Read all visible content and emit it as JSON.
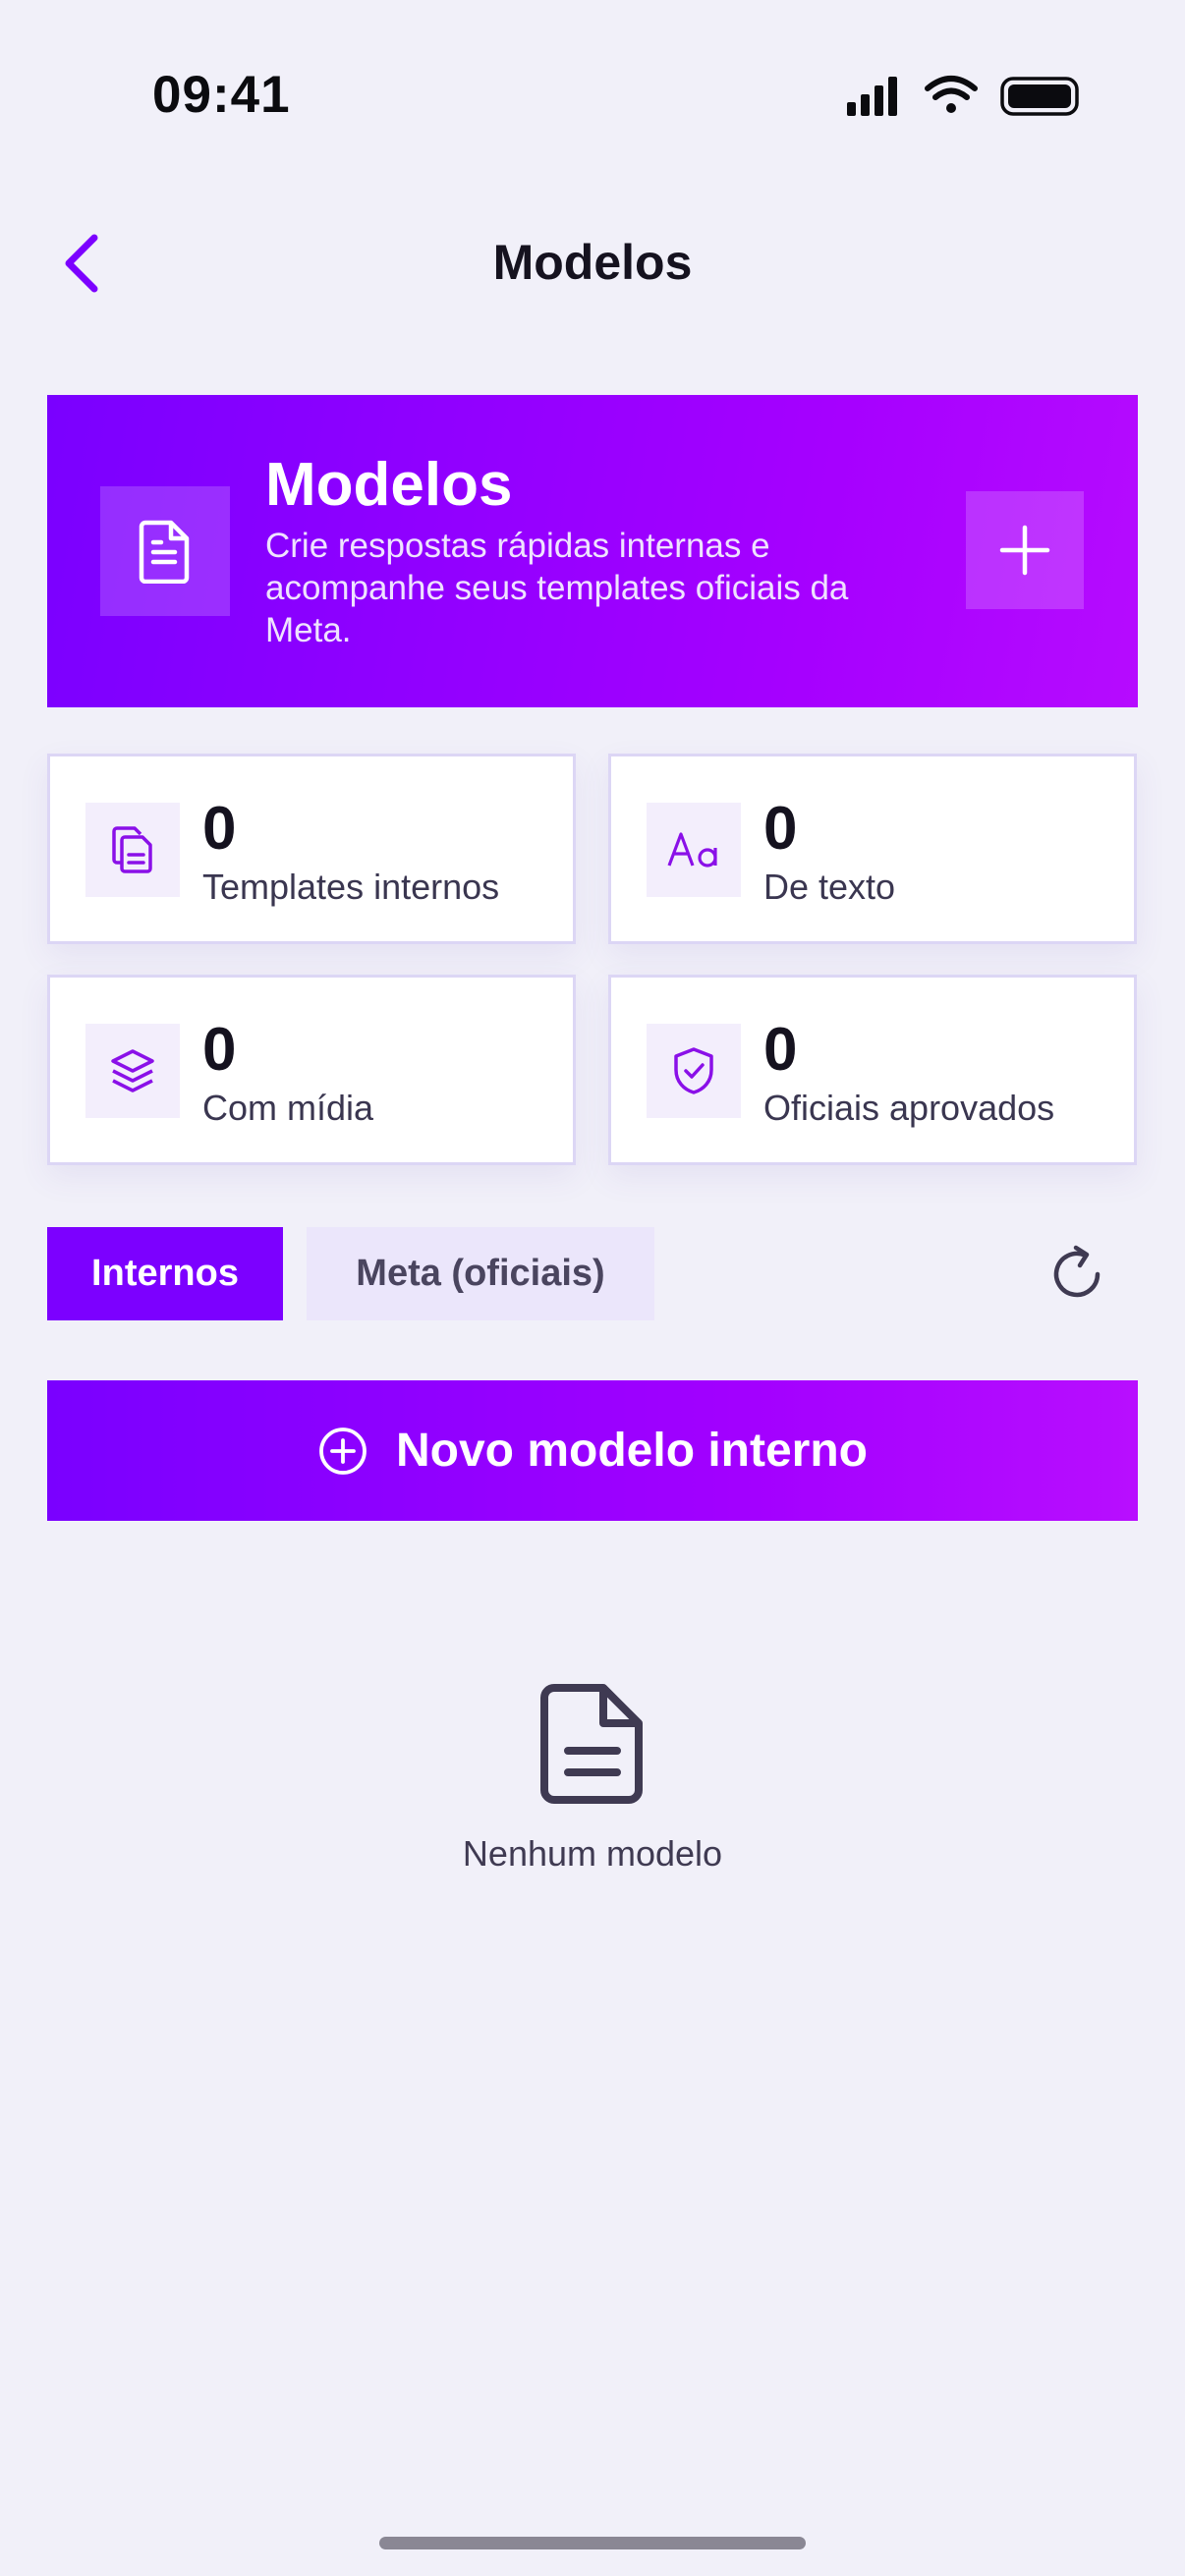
{
  "status_bar": {
    "time": "09:41"
  },
  "nav": {
    "title": "Modelos"
  },
  "hero": {
    "title": "Modelos",
    "subtitle": "Crie respostas rápidas internas e acompanhe seus templates oficiais da Meta."
  },
  "stats": [
    {
      "value": "0",
      "label": "Templates internos",
      "icon": "documents-icon"
    },
    {
      "value": "0",
      "label": "De texto",
      "icon": "text-aa-icon"
    },
    {
      "value": "0",
      "label": "Com mídia",
      "icon": "layers-icon"
    },
    {
      "value": "0",
      "label": "Oficiais aprovados",
      "icon": "shield-check-icon"
    }
  ],
  "tabs": [
    {
      "label": "Internos",
      "active": true
    },
    {
      "label": "Meta (oficiais)",
      "active": false
    }
  ],
  "actions": {
    "new_internal": "Novo modelo interno"
  },
  "empty_state": {
    "text": "Nenhum modelo"
  },
  "colors": {
    "accent": "#7c00ff",
    "background": "#f1f0f9",
    "gradient_end": "#b80eff"
  }
}
